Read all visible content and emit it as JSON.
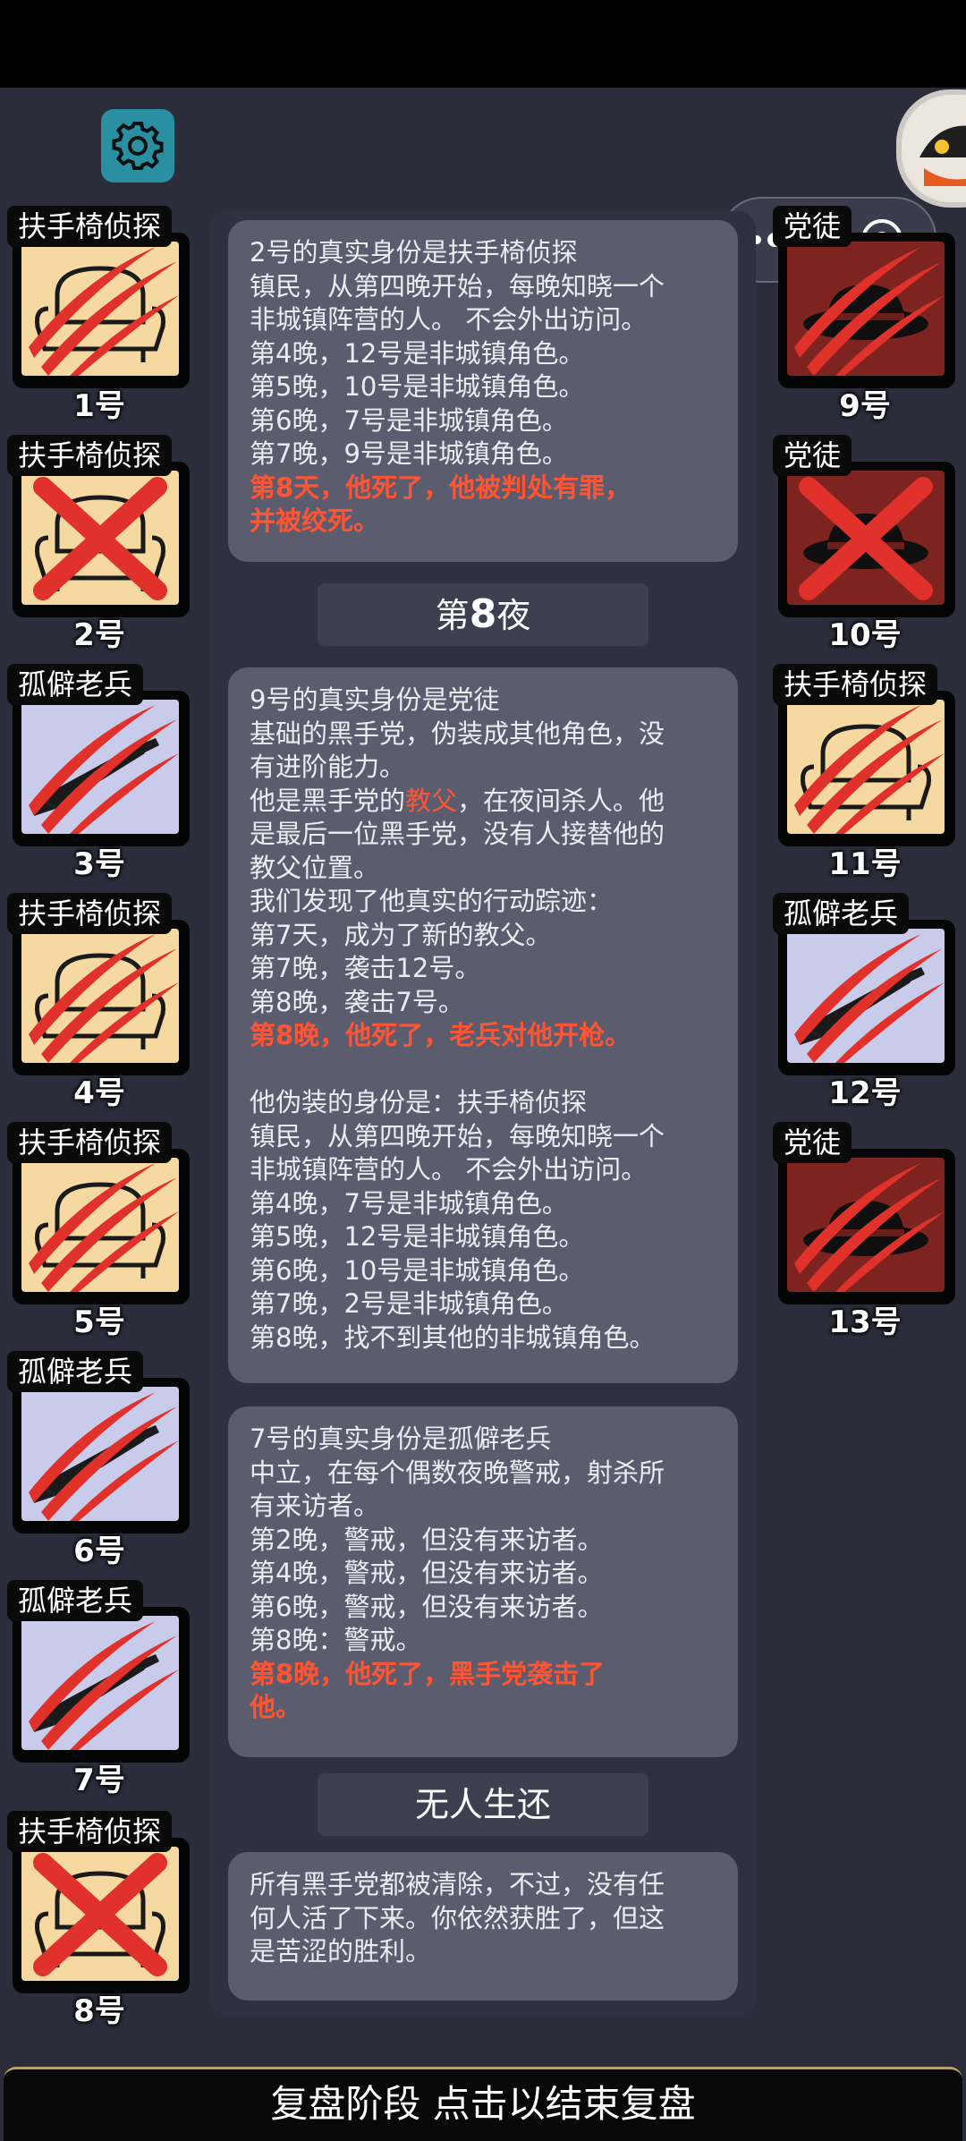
{
  "top_controls": {
    "settings_icon": "gear-icon",
    "menu_icon": "more-dots-icon",
    "close_icon": "target-circle-icon"
  },
  "players": [
    {
      "role": "扶手椅侦探",
      "number": "1号",
      "art": "armchair",
      "state": "killed-claw"
    },
    {
      "role": "扶手椅侦探",
      "number": "2号",
      "art": "armchair",
      "state": "executed-x"
    },
    {
      "role": "孤僻老兵",
      "number": "3号",
      "art": "veteran",
      "state": "killed-claw"
    },
    {
      "role": "扶手椅侦探",
      "number": "4号",
      "art": "armchair",
      "state": "killed-claw"
    },
    {
      "role": "扶手椅侦探",
      "number": "5号",
      "art": "armchair",
      "state": "killed-claw"
    },
    {
      "role": "孤僻老兵",
      "number": "6号",
      "art": "veteran",
      "state": "killed-claw"
    },
    {
      "role": "孤僻老兵",
      "number": "7号",
      "art": "veteran",
      "state": "killed-claw"
    },
    {
      "role": "扶手椅侦探",
      "number": "8号",
      "art": "armchair",
      "state": "executed-x"
    },
    {
      "role": "党徒",
      "number": "9号",
      "art": "mafia",
      "state": "killed-claw"
    },
    {
      "role": "党徒",
      "number": "10号",
      "art": "mafia",
      "state": "executed-x"
    },
    {
      "role": "扶手椅侦探",
      "number": "11号",
      "art": "armchair",
      "state": "killed-claw"
    },
    {
      "role": "孤僻老兵",
      "number": "12号",
      "art": "veteran",
      "state": "killed-claw"
    },
    {
      "role": "党徒",
      "number": "13号",
      "art": "mafia",
      "state": "killed-claw"
    }
  ],
  "log": {
    "box1": [
      "2号的真实身份是扶手椅侦探",
      "镇民，从第四晚开始，每晚知晓一个",
      "非城镇阵营的人。 不会外出访问。",
      "第4晚，12号是非城镇角色。",
      "第5晚，10号是非城镇角色。",
      "第6晚，7号是非城镇角色。",
      "第7晚，9号是非城镇角色。"
    ],
    "box1_red": [
      "第8天，他死了，他被判处有罪，",
      "并被绞死。"
    ],
    "night_prefix": "第",
    "night_number": "8",
    "night_suffix": "夜",
    "box2_a": [
      "9号的真实身份是党徒",
      "基础的黑手党，伪装成其他角色，没",
      "有进阶能力。"
    ],
    "box2_line4_a": "他是黑手党的",
    "box2_line4_hl": "教父",
    "box2_line4_b": "，在夜间杀人。他",
    "box2_b": [
      "是最后一位黑手党，没有人接替他的",
      "教父位置。",
      "我们发现了他真实的行动踪迹：",
      "第7天，成为了新的教父。",
      "第7晚，袭击12号。",
      "第8晚，袭击7号。"
    ],
    "box2_red": "第8晚，他死了，老兵对他开枪。",
    "box2_c": [
      "他伪装的身份是：扶手椅侦探",
      "镇民，从第四晚开始，每晚知晓一个",
      "非城镇阵营的人。 不会外出访问。",
      "第4晚，7号是非城镇角色。",
      "第5晚，12号是非城镇角色。",
      "第6晚，10号是非城镇角色。",
      "第7晚，2号是非城镇角色。",
      "第8晚，找不到其他的非城镇角色。"
    ],
    "box3": [
      "7号的真实身份是孤僻老兵",
      "中立，在每个偶数夜晚警戒，射杀所",
      "有来访者。",
      "第2晚，警戒，但没有来访者。",
      "第4晚，警戒，但没有来访者。",
      "第6晚，警戒，但没有来访者。",
      "第8晚：警戒。"
    ],
    "box3_red": [
      "第8晚，他死了，黑手党袭击了",
      "他。"
    ],
    "end_title": "无人生还",
    "box4": [
      "所有黑手党都被清除，不过，没有任",
      "何人活了下来。你依然获胜了，但这",
      "是苦涩的胜利。"
    ]
  },
  "bottom_bar": "复盘阶段 点击以结束复盘",
  "colors": {
    "death_red": "#ff5534",
    "claw_red": "#e0312b"
  }
}
